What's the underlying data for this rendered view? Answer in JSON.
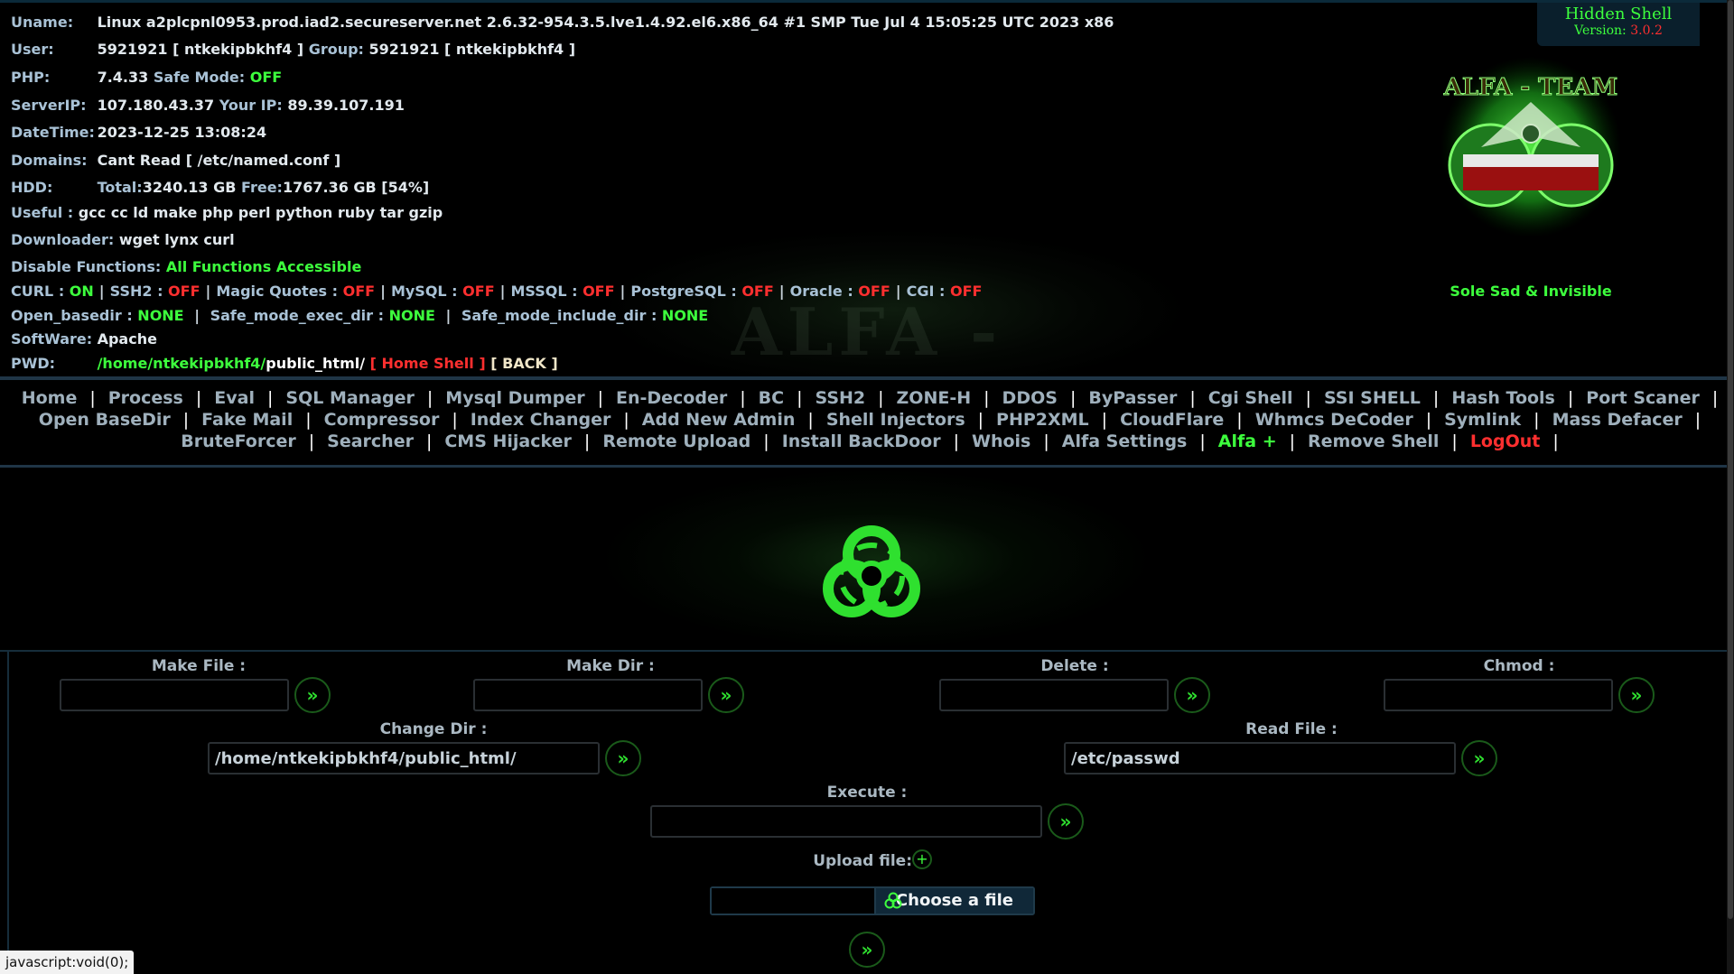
{
  "info": {
    "uname_label": "Uname:",
    "uname_value": "Linux a2plcpnl0953.prod.iad2.secureserver.net 2.6.32-954.3.5.lve1.4.92.el6.x86_64 #1 SMP Tue Jul 4 15:05:25 UTC 2023 x86",
    "user_label": "User:",
    "user_value": "5921921 [ ntkekipbkhf4 ]",
    "group_label": "Group:",
    "group_value": "5921921 [ ntkekipbkhf4 ]",
    "php_label": "PHP:",
    "php_version": "7.4.33",
    "safe_mode_label": "Safe Mode:",
    "safe_mode_value": "OFF",
    "serverip_label": "ServerIP:",
    "serverip_value": "107.180.43.37",
    "yourip_label": "Your IP:",
    "yourip_value": "89.39.107.191",
    "datetime_label": "DateTime:",
    "datetime_value": "2023-12-25 13:08:24",
    "domains_label": "Domains:",
    "domains_value": "Cant Read [ /etc/named.conf ]",
    "hdd_label": "HDD:",
    "hdd_total_label": "Total:",
    "hdd_total_value": "3240.13 GB",
    "hdd_free_label": "Free:",
    "hdd_free_value": "1767.36 GB [54%]",
    "useful_label": "Useful :",
    "useful_value": "gcc cc ld make php perl python ruby tar gzip",
    "downloader_label": "Downloader:",
    "downloader_value": "wget lynx curl",
    "disable_label": "Disable Functions:",
    "disable_value": "All Functions Accessible",
    "flags": [
      {
        "name": "CURL",
        "value": "ON",
        "color": "#3dff3d"
      },
      {
        "name": "SSH2",
        "value": "OFF",
        "color": "#ff2f2f"
      },
      {
        "name": "Magic Quotes",
        "value": "OFF",
        "color": "#ff2f2f"
      },
      {
        "name": "MySQL",
        "value": "OFF",
        "color": "#ff2f2f"
      },
      {
        "name": "MSSQL",
        "value": "OFF",
        "color": "#ff2f2f"
      },
      {
        "name": "PostgreSQL",
        "value": "OFF",
        "color": "#ff2f2f"
      },
      {
        "name": "Oracle",
        "value": "OFF",
        "color": "#ff2f2f"
      },
      {
        "name": "CGI",
        "value": "OFF",
        "color": "#ff2f2f"
      }
    ],
    "open_basedir_label": "Open_basedir :",
    "open_basedir_value": "NONE",
    "exec_dir_label": "Safe_mode_exec_dir :",
    "exec_dir_value": "NONE",
    "include_dir_label": "Safe_mode_include_dir :",
    "include_dir_value": "NONE",
    "software_label": "SoftWare:",
    "software_value": "Apache",
    "pwd_label": "PWD:",
    "pwd_green": "/home/ntkekipbkhf4/",
    "pwd_white": "public_html/",
    "home_shell_label": "[ Home Shell ]",
    "back_label": "[ BACK ]"
  },
  "brand": {
    "hidden_title": "Hidden Shell",
    "version_label": "Version:",
    "version_value": "3.0.2",
    "logo_text": "ALFA - TEAM",
    "watermark_text": "ALFA - TEAM",
    "slogan": "Sole Sad & Invisible"
  },
  "menu": {
    "row1": [
      "Home",
      "Process",
      "Eval",
      "SQL Manager",
      "Mysql Dumper",
      "En-Decoder",
      "BC",
      "SSH2",
      "ZONE-H",
      "DDOS",
      "ByPasser",
      "Cgi Shell",
      "SSI SHELL",
      "Hash Tools",
      "Port Scaner"
    ],
    "row2": [
      "Open BaseDir",
      "Fake Mail",
      "Compressor",
      "Index Changer",
      "Add New Admin",
      "Shell Injectors",
      "PHP2XML",
      "CloudFlare",
      "Whmcs DeCoder",
      "Symlink",
      "Mass Defacer"
    ],
    "row3": [
      "BruteForcer",
      "Searcher",
      "CMS Hijacker",
      "Remote Upload",
      "Install BackDoor",
      "Whois",
      "Alfa Settings",
      "Alfa +",
      "Remove Shell",
      "LogOut"
    ],
    "highlight_color": "#3dff3d",
    "logout_color": "#ff2f2f"
  },
  "tools": {
    "make_file_label": "Make File :",
    "make_dir_label": "Make Dir :",
    "delete_label": "Delete :",
    "chmod_label": "Chmod :",
    "change_dir_label": "Change Dir :",
    "change_dir_value": "/home/ntkekipbkhf4/public_html/",
    "read_file_label": "Read File :",
    "read_file_value": "/etc/passwd",
    "execute_label": "Execute :",
    "upload_label": "Upload file:",
    "choose_label": "Choose a file",
    "go_glyph": "»",
    "plus_glyph": "+"
  },
  "status_text": "javascript:void(0);",
  "colors": {
    "accent_green": "#3dff3d",
    "alert_red": "#ff2f2f",
    "border_blue": "#1f3546"
  }
}
